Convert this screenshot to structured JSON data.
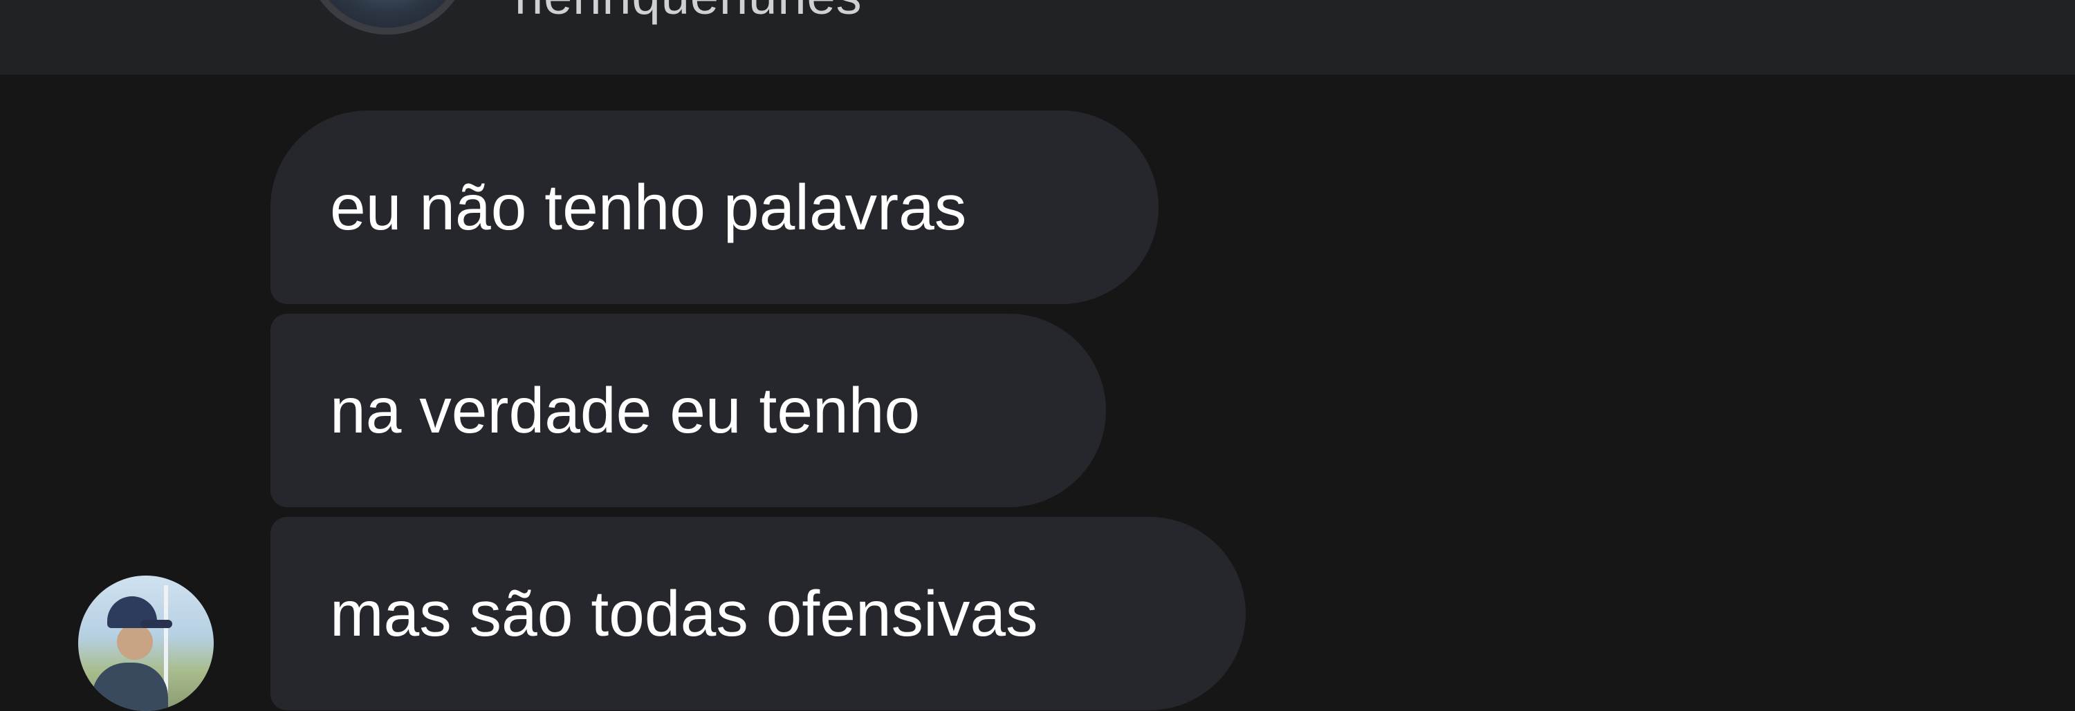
{
  "header": {
    "username": "henriquenunes"
  },
  "messages": [
    {
      "text": "eu não tenho palavras"
    },
    {
      "text": "na verdade eu tenho"
    },
    {
      "text": "mas são todas ofensivas"
    }
  ],
  "colors": {
    "background": "#161616",
    "header_background": "#212226",
    "bubble_background": "#26272c",
    "bubble_text": "#ffffff"
  }
}
